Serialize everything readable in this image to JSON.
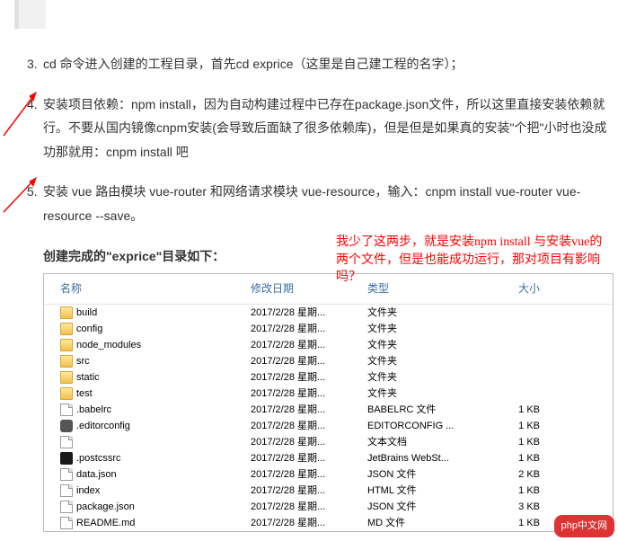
{
  "steps": {
    "s3": "cd 命令进入创建的工程目录，首先cd exprice（这里是自己建工程的名字）；",
    "s4": "安装项目依赖：npm install，因为自动构建过程中已存在package.json文件，所以这里直接安装依赖就行。不要从国内镜像cnpm安装(会导致后面缺了很多依赖库)，但是但是如果真的安装\"个把\"小时也没成功那就用：cnpm install 吧",
    "s5": "安装 vue 路由模块 vue-router 和网络请求模块 vue-resource，输入：cnpm install vue-router vue-resource --save。"
  },
  "heading": "创建完成的\"exprice\"目录如下：",
  "annotation": "我少了这两步，就是安装npm install 与安装vue的两个文件，但是也能成功运行，那对项目有影响吗？",
  "explorer": {
    "columns": {
      "name": "名称",
      "date": "修改日期",
      "type": "类型",
      "size": "大小"
    },
    "rows": [
      {
        "icon": "folder",
        "name": "build",
        "date": "2017/2/28 星期...",
        "type": "文件夹",
        "size": ""
      },
      {
        "icon": "folder",
        "name": "config",
        "date": "2017/2/28 星期...",
        "type": "文件夹",
        "size": ""
      },
      {
        "icon": "folder",
        "name": "node_modules",
        "date": "2017/2/28 星期...",
        "type": "文件夹",
        "size": ""
      },
      {
        "icon": "folder",
        "name": "src",
        "date": "2017/2/28 星期...",
        "type": "文件夹",
        "size": ""
      },
      {
        "icon": "folder",
        "name": "static",
        "date": "2017/2/28 星期...",
        "type": "文件夹",
        "size": ""
      },
      {
        "icon": "folder",
        "name": "test",
        "date": "2017/2/28 星期...",
        "type": "文件夹",
        "size": ""
      },
      {
        "icon": "file",
        "name": ".babelrc",
        "date": "2017/2/28 星期...",
        "type": "BABELRC 文件",
        "size": "1 KB"
      },
      {
        "icon": "gear",
        "name": ".editorconfig",
        "date": "2017/2/28 星期...",
        "type": "EDITORCONFIG ...",
        "size": "1 KB"
      },
      {
        "icon": "file",
        "name": "",
        "date": "2017/2/28 星期...",
        "type": "文本文档",
        "size": "1 KB"
      },
      {
        "icon": "ws",
        "name": ".postcssrc",
        "date": "2017/2/28 星期...",
        "type": "JetBrains WebSt...",
        "size": "1 KB"
      },
      {
        "icon": "file",
        "name": "data.json",
        "date": "2017/2/28 星期...",
        "type": "JSON 文件",
        "size": "2 KB"
      },
      {
        "icon": "file",
        "name": "index",
        "date": "2017/2/28 星期...",
        "type": "HTML 文件",
        "size": "1 KB"
      },
      {
        "icon": "file",
        "name": "package.json",
        "date": "2017/2/28 星期...",
        "type": "JSON 文件",
        "size": "3 KB"
      },
      {
        "icon": "file",
        "name": "README.md",
        "date": "2017/2/28 星期...",
        "type": "MD 文件",
        "size": "1 KB"
      }
    ]
  },
  "watermark": "php中文网"
}
